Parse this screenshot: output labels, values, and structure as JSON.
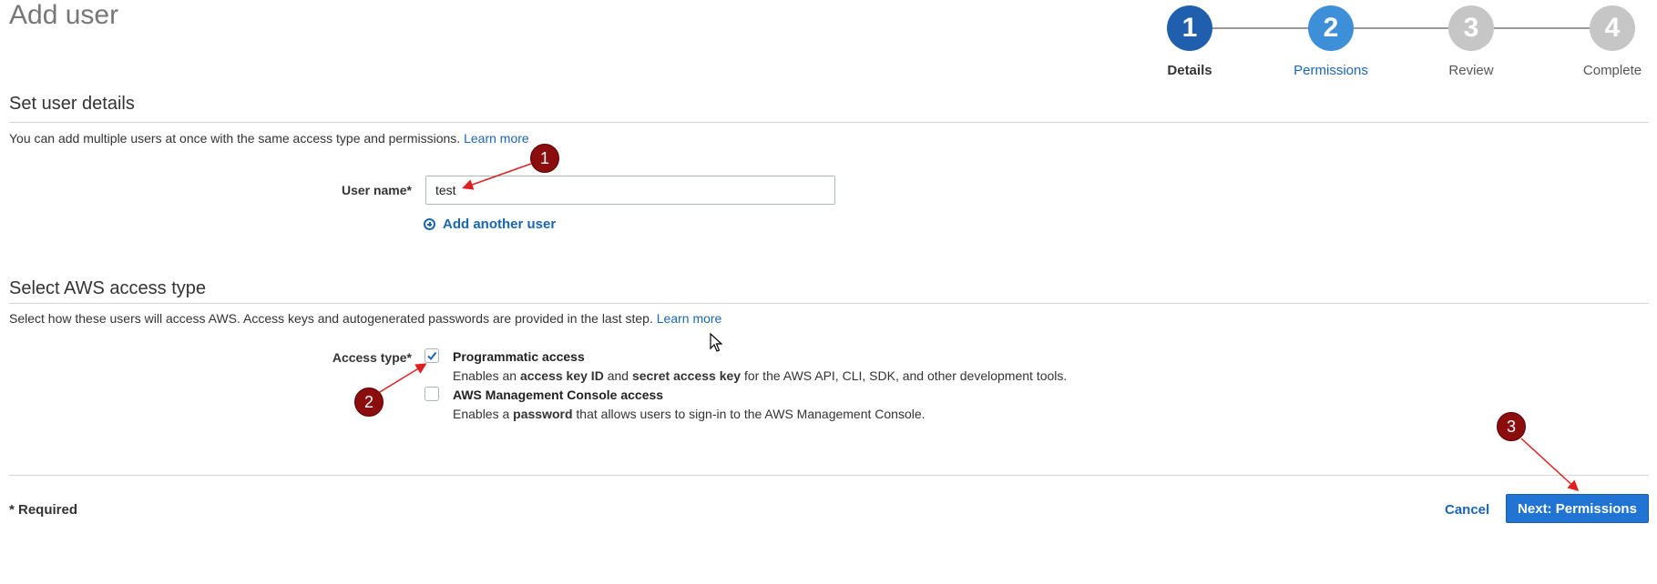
{
  "page": {
    "title": "Add user"
  },
  "wizard": {
    "steps": [
      {
        "number": "1",
        "label": "Details",
        "state": "current"
      },
      {
        "number": "2",
        "label": "Permissions",
        "state": "next"
      },
      {
        "number": "3",
        "label": "Review",
        "state": "pending"
      },
      {
        "number": "4",
        "label": "Complete",
        "state": "pending"
      }
    ],
    "colors": {
      "current": "#1f5fad",
      "next": "#3d8fd8",
      "pending": "#c6c6c6",
      "current_label": "#333333",
      "next_label": "#1a66b3",
      "pending_label": "#555555"
    }
  },
  "user_details": {
    "heading": "Set user details",
    "description": "You can add multiple users at once with the same access type and permissions.",
    "learn_more": "Learn more",
    "user_name_label": "User name*",
    "user_name_value": "test",
    "add_another_user": "Add another user"
  },
  "access_type": {
    "heading": "Select AWS access type",
    "description": "Select how these users will access AWS. Access keys and autogenerated passwords are provided in the last step.",
    "learn_more": "Learn more",
    "label": "Access type*",
    "options": [
      {
        "title": "Programmatic access",
        "checked": true,
        "desc_parts": [
          "Enables an ",
          "access key ID",
          " and ",
          "secret access key",
          " for the AWS API, CLI, SDK, and other development tools."
        ]
      },
      {
        "title": "AWS Management Console access",
        "checked": false,
        "desc_parts": [
          "Enables a ",
          "password",
          " that allows users to sign-in to the AWS Management Console."
        ]
      }
    ]
  },
  "footer": {
    "required_note": "* Required",
    "cancel": "Cancel",
    "next": "Next: Permissions"
  },
  "annotations": [
    "1",
    "2",
    "3"
  ],
  "accent_colors": {
    "link": "#1a66b3",
    "primary_button": "#2174d3",
    "annotation": "#8b0d0d"
  }
}
